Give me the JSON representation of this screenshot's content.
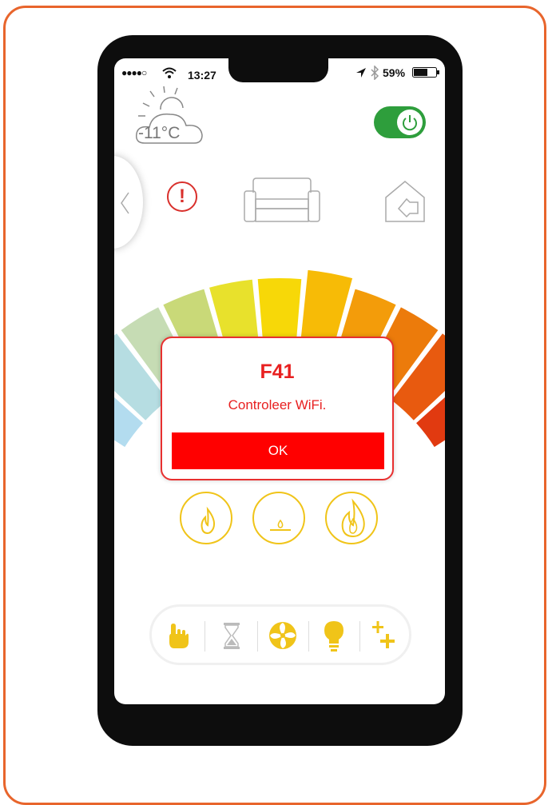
{
  "status_bar": {
    "signal": "●●●●○",
    "time": "13:27",
    "battery": "59%"
  },
  "weather": {
    "temperature": "-11°C",
    "icon": "partly-cloudy-icon"
  },
  "power_toggle": {
    "state": "on",
    "icon": "power-icon",
    "color": "#2e9e3c"
  },
  "nav_icons": [
    "chevron-left-icon",
    "alert-icon",
    "sofa-icon",
    "home-exit-icon"
  ],
  "alert_symbol": "!",
  "dialog": {
    "code": "F41",
    "message": "Controleer  WiFi.",
    "ok_label": "OK",
    "accent": "#ff0000"
  },
  "gauge_colors": [
    "#b3dcef",
    "#b6dde2",
    "#c6dcb4",
    "#c9d978",
    "#e8e12c",
    "#f7d808",
    "#f7bb06",
    "#f39c0a",
    "#ec7b0b",
    "#e85a0f",
    "#e13a10"
  ],
  "mode_buttons": [
    {
      "name": "flame-small-icon"
    },
    {
      "name": "pilot-flame-icon"
    },
    {
      "name": "flame-large-icon"
    }
  ],
  "bottom_bar": [
    {
      "name": "hand-manual-icon"
    },
    {
      "name": "hourglass-timer-icon"
    },
    {
      "name": "fan-icon"
    },
    {
      "name": "light-bulb-icon"
    },
    {
      "name": "plus-more-icon"
    }
  ]
}
